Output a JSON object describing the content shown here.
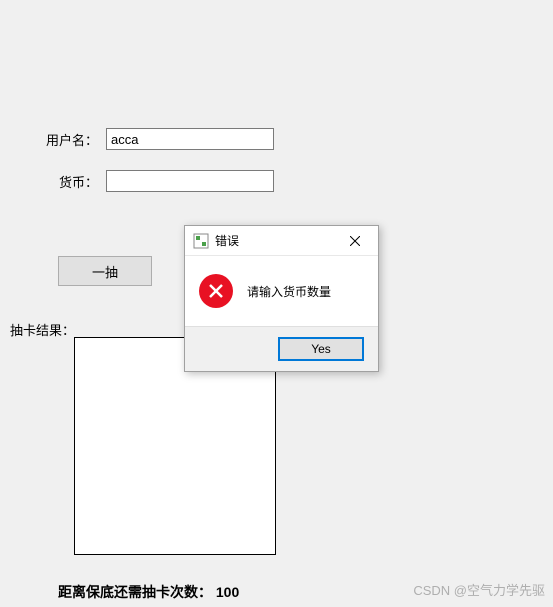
{
  "form": {
    "username_label": "用户名：",
    "username_value": "acca",
    "currency_label": "货币：",
    "currency_value": ""
  },
  "buttons": {
    "draw": "一抽"
  },
  "result": {
    "label": "抽卡结果："
  },
  "pity": {
    "text": "距离保底还需抽卡次数： 100"
  },
  "dialog": {
    "title": "错误",
    "message": "请输入货币数量",
    "yes": "Yes"
  },
  "watermark": "CSDN @空气力学先驱"
}
